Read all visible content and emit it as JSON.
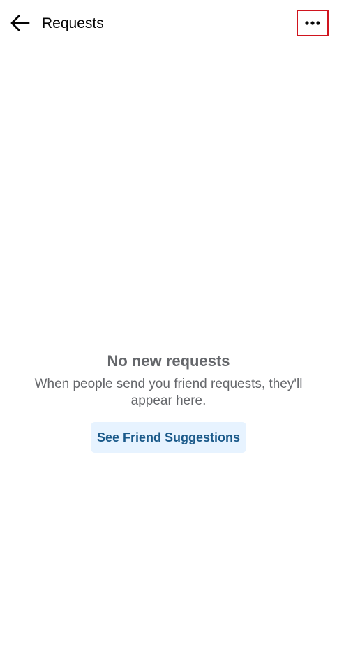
{
  "header": {
    "title": "Requests",
    "back_icon": "arrow-left-icon",
    "more_icon": "more-horizontal-icon",
    "highlight_color": "#d0141e"
  },
  "empty_state": {
    "title": "No new requests",
    "description": "When people send you friend requests, they'll appear here.",
    "button_label": "See Friend Suggestions",
    "button_bg": "#e7f3ff",
    "button_text_color": "#1b5a8a"
  }
}
